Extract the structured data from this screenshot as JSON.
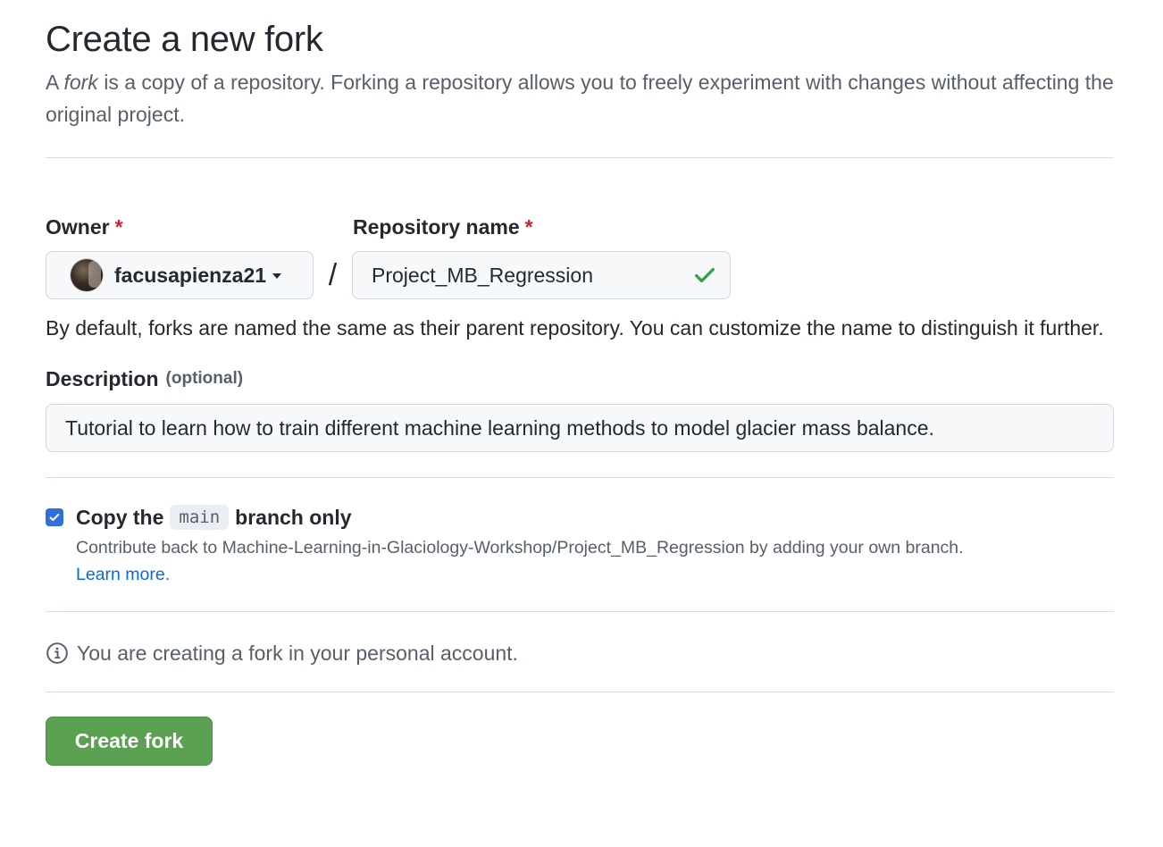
{
  "header": {
    "title": "Create a new fork",
    "lead_prefix": "A ",
    "lead_em": "fork",
    "lead_suffix": " is a copy of a repository. Forking a repository allows you to freely experiment with changes without affecting the original project."
  },
  "owner": {
    "label": "Owner",
    "required_mark": "*",
    "value": "facusapienza21",
    "icon": "chevron-down-icon"
  },
  "separator": "/",
  "repository": {
    "label": "Repository name",
    "required_mark": "*",
    "value": "Project_MB_Regression",
    "status_icon": "check-icon",
    "status_color": "#2da44e"
  },
  "name_hint": "By default, forks are named the same as their parent repository. You can customize the name to distinguish it further.",
  "description": {
    "label": "Description",
    "optional": "(optional)",
    "value": "Tutorial to learn how to train different machine learning methods to model glacier mass balance."
  },
  "copy_branch": {
    "checked": true,
    "prefix": "Copy the",
    "branch": "main",
    "suffix": "branch only",
    "desc": "Contribute back to Machine-Learning-in-Glaciology-Workshop/Project_MB_Regression by adding your own branch.",
    "link": "Learn more."
  },
  "info": {
    "icon": "info-icon",
    "text": "You are creating a fork in your personal account."
  },
  "submit": {
    "label": "Create fork",
    "color": "#5aa252"
  }
}
